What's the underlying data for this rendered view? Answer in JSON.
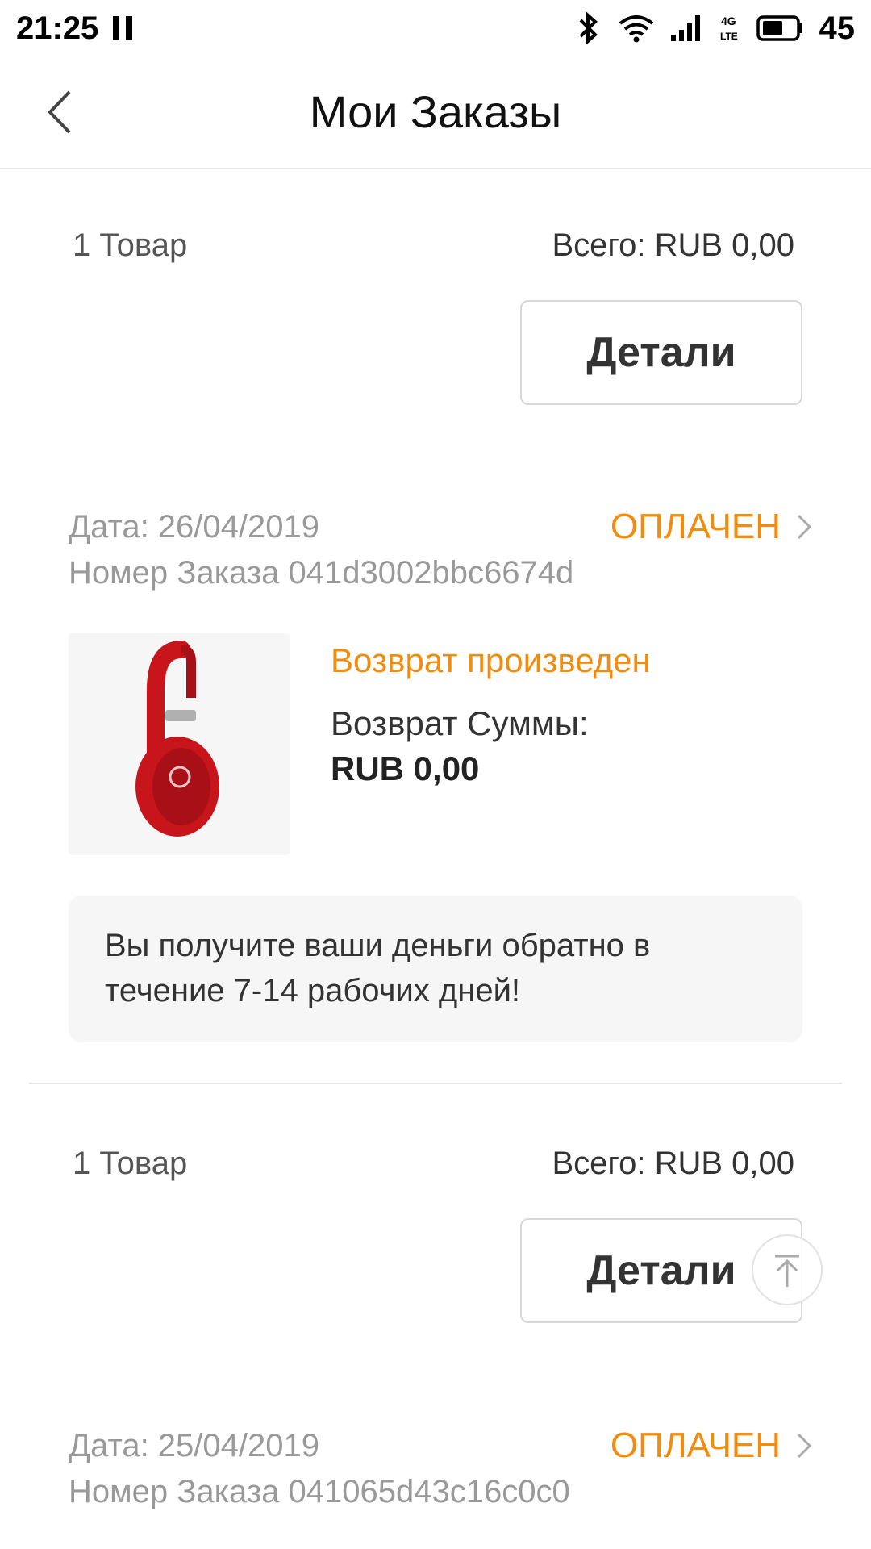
{
  "status_bar": {
    "time": "21:25",
    "battery": "45"
  },
  "header": {
    "title": "Мои Заказы"
  },
  "orders_top": {
    "items_count": "1 Товар",
    "total": "Всего: RUB 0,00",
    "details_label": "Детали"
  },
  "order1": {
    "date": "Дата: 26/04/2019",
    "status": "ОПЛАЧЕН",
    "number": "Номер Заказа 041d3002bbc6674d",
    "refund_status": "Возврат произведен",
    "refund_label": "Возврат Суммы:",
    "refund_amount": "RUB 0,00",
    "notice": "Вы получите ваши деньги обратно в течение 7-14 рабочих дней!",
    "items_count": "1 Товар",
    "total": "Всего: RUB 0,00",
    "details_label": "Детали"
  },
  "order2": {
    "date": "Дата: 25/04/2019",
    "status": "ОПЛАЧЕН",
    "number": "Номер Заказа 041065d43c16c0c0"
  },
  "colors": {
    "accent": "#f28c0f",
    "product": "#c8151c"
  },
  "icons": {
    "back": "chevron-left-icon",
    "status": "chevron-right-icon",
    "scroll": "scroll-to-top-icon"
  }
}
